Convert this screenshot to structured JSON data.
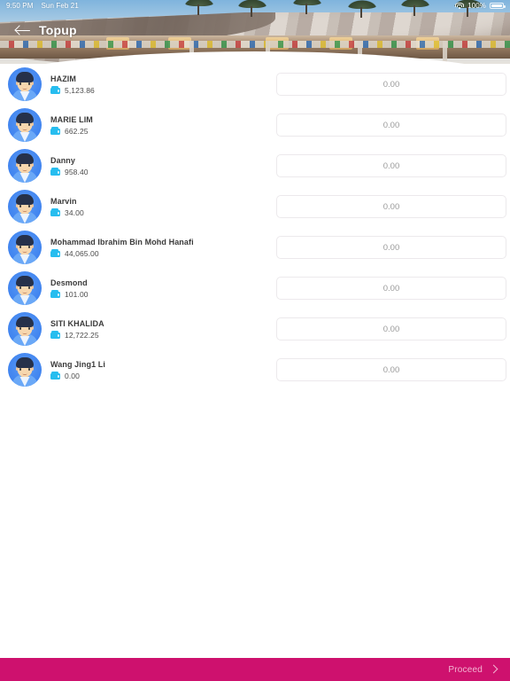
{
  "status_bar": {
    "time": "9:50 PM",
    "date": "Sun Feb 21",
    "wifi_icon": "wifi-icon",
    "battery_percent": "100%",
    "battery_icon": "battery-icon"
  },
  "header": {
    "back_icon": "back-arrow-icon",
    "title": "Topup",
    "banner_image": "building-banner-photo"
  },
  "list": {
    "amount_placeholder": "0.00",
    "wallet_icon": "wallet-icon",
    "avatar_icon": "avatar",
    "rows": [
      {
        "name": "HAZIM",
        "balance": "5,123.86",
        "amount": ""
      },
      {
        "name": "MARIE LIM",
        "balance": "662.25",
        "amount": ""
      },
      {
        "name": "Danny",
        "balance": "958.40",
        "amount": ""
      },
      {
        "name": "Marvin",
        "balance": "34.00",
        "amount": ""
      },
      {
        "name": "Mohammad Ibrahim Bin Mohd Hanafi",
        "balance": "44,065.00",
        "amount": ""
      },
      {
        "name": "Desmond",
        "balance": "101.00",
        "amount": ""
      },
      {
        "name": "SITI KHALIDA",
        "balance": "12,722.25",
        "amount": ""
      },
      {
        "name": "Wang Jing1 Li",
        "balance": "0.00",
        "amount": ""
      }
    ]
  },
  "footer": {
    "proceed_label": "Proceed",
    "chevron_icon": "chevron-right-icon",
    "bar_color": "#ce116e",
    "label_color": "#f2b6d3"
  },
  "theme": {
    "accent_blue": "#3f83ef",
    "wallet_cyan": "#27bdef",
    "name_text": "#3b3b3b",
    "balance_text": "#4b4b4b",
    "input_border": "#ece9ec",
    "placeholder_text": "#9a9a9a"
  }
}
